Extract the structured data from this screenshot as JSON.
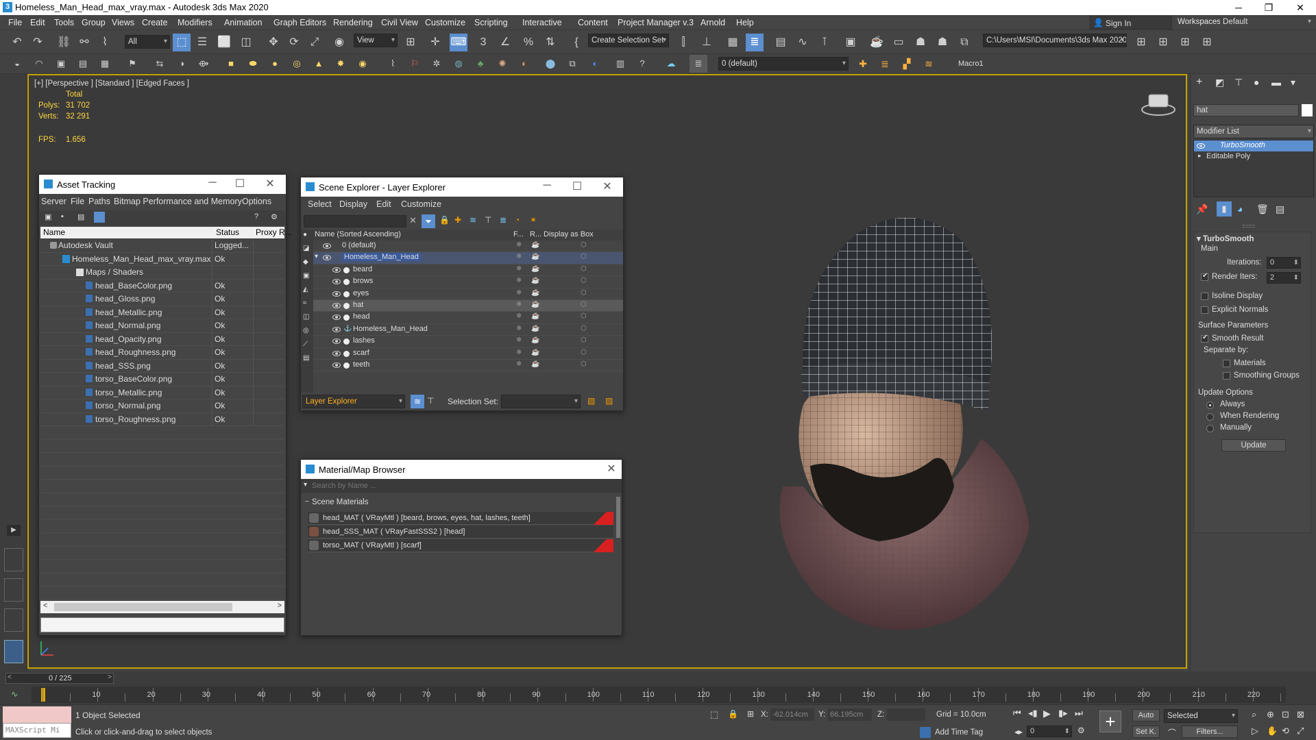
{
  "window": {
    "title": "Homeless_Man_Head_max_vray.max - Autodesk 3ds Max 2020"
  },
  "menubar": [
    "File",
    "Edit",
    "Tools",
    "Group",
    "Views",
    "Create",
    "Modifiers",
    "Animation",
    "Graph Editors",
    "Rendering",
    "Civil View",
    "Customize",
    "Scripting",
    "Interactive",
    "Content",
    "Project Manager v.3",
    "Arnold",
    "Help"
  ],
  "account": {
    "sign_in": "Sign In",
    "workspaces_label": "Workspaces:",
    "workspace": "Default"
  },
  "toolbar": {
    "filter": "All",
    "ref_coord": "View",
    "selection_set": "Create Selection Set",
    "project_path": "C:\\Users\\MSI\\Documents\\3ds Max 2020",
    "layer": "0 (default)",
    "macro": "Macro1"
  },
  "viewport": {
    "label": "[+] [Perspective ] [Standard ] [Edged Faces ]",
    "stats_total": "Total",
    "polys_label": "Polys:",
    "polys": "31 702",
    "verts_label": "Verts:",
    "verts": "32 291",
    "fps_label": "FPS:",
    "fps": "1.656"
  },
  "asset_tracking": {
    "title": "Asset Tracking",
    "menu": [
      "Server",
      "File",
      "Paths",
      "Bitmap Performance and Memory",
      "Options"
    ],
    "columns": [
      "Name",
      "Status",
      "Proxy R..."
    ],
    "rows": [
      {
        "name": "Autodesk Vault",
        "status": "Logged..."
      },
      {
        "name": "Homeless_Man_Head_max_vray.max",
        "status": "Ok"
      },
      {
        "name": "Maps / Shaders",
        "status": ""
      },
      {
        "name": "head_BaseColor.png",
        "status": "Ok"
      },
      {
        "name": "head_Gloss.png",
        "status": "Ok"
      },
      {
        "name": "head_Metallic.png",
        "status": "Ok"
      },
      {
        "name": "head_Normal.png",
        "status": "Ok"
      },
      {
        "name": "head_Opacity.png",
        "status": "Ok"
      },
      {
        "name": "head_Roughness.png",
        "status": "Ok"
      },
      {
        "name": "head_SSS.png",
        "status": "Ok"
      },
      {
        "name": "torso_BaseColor.png",
        "status": "Ok"
      },
      {
        "name": "torso_Metallic.png",
        "status": "Ok"
      },
      {
        "name": "torso_Normal.png",
        "status": "Ok"
      },
      {
        "name": "torso_Roughness.png",
        "status": "Ok"
      }
    ]
  },
  "scene_explorer": {
    "title": "Scene Explorer - Layer Explorer",
    "menu": [
      "Select",
      "Display",
      "Edit",
      "Customize"
    ],
    "columns": [
      "Name (Sorted Ascending)",
      "F...",
      "R...",
      "Display as Box"
    ],
    "rows": [
      {
        "name": "0 (default)"
      },
      {
        "name": "Homeless_Man_Head"
      },
      {
        "name": "beard"
      },
      {
        "name": "brows"
      },
      {
        "name": "eyes"
      },
      {
        "name": "hat"
      },
      {
        "name": "head"
      },
      {
        "name": "Homeless_Man_Head"
      },
      {
        "name": "lashes"
      },
      {
        "name": "scarf"
      },
      {
        "name": "teeth"
      }
    ],
    "footer_mode": "Layer Explorer",
    "selection_set_label": "Selection Set:"
  },
  "material_browser": {
    "title": "Material/Map Browser",
    "search_placeholder": "Search by Name ...",
    "group": "Scene Materials",
    "items": [
      "head_MAT  ( VRayMtl )  [beard, brows, eyes, hat, lashes, teeth]",
      "head_SSS_MAT  ( VRayFastSSS2 )  [head]",
      "torso_MAT  ( VRayMtl )  [scarf]"
    ]
  },
  "command_panel": {
    "object_name": "hat",
    "modifier_list": "Modifier List",
    "stack": [
      "TurboSmooth",
      "Editable Poly"
    ],
    "rollout": "TurboSmooth",
    "main": "Main",
    "iterations_label": "Iterations:",
    "iterations": "0",
    "render_iters_label": "Render Iters:",
    "render_iters": "2",
    "isoline": "Isoline Display",
    "explicit": "Explicit Normals",
    "surface_params": "Surface Parameters",
    "smooth_result": "Smooth Result",
    "separate_by": "Separate by:",
    "materials": "Materials",
    "smoothing_groups": "Smoothing Groups",
    "update_options": "Update Options",
    "always": "Always",
    "when_rendering": "When Rendering",
    "manually": "Manually",
    "update_button": "Update"
  },
  "timeline": {
    "frame": "0 / 225",
    "ticks": [
      "10",
      "20",
      "30",
      "40",
      "50",
      "60",
      "70",
      "80",
      "90",
      "100",
      "110",
      "120",
      "130",
      "140",
      "150",
      "160",
      "170",
      "180",
      "190",
      "200",
      "210",
      "220"
    ]
  },
  "status": {
    "maxscript": "MAXScript Mi",
    "selected": "1 Object Selected",
    "prompt": "Click or click-and-drag to select objects",
    "x_label": "X:",
    "x": "-62.014cm",
    "y_label": "Y:",
    "y": "66.195cm",
    "z_label": "Z:",
    "grid": "Grid = 10.0cm",
    "add_time_tag": "Add Time Tag",
    "auto": "Auto",
    "set_key": "Set K.",
    "key_filter": "Selected",
    "filters": "Filters...",
    "frame_field": "0"
  }
}
